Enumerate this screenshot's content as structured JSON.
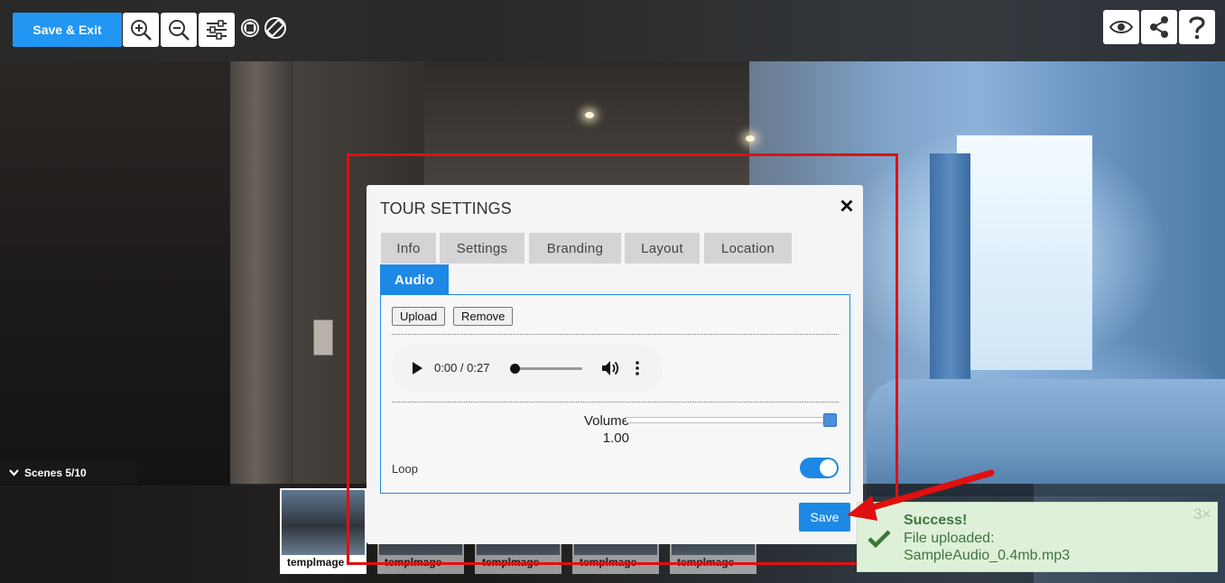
{
  "toolbar": {
    "save_exit_label": "Save & Exit",
    "tools": [
      {
        "icon": "zoom-in-icon"
      },
      {
        "icon": "zoom-out-icon"
      },
      {
        "icon": "sliders-icon"
      },
      {
        "icon": "stop-icon"
      },
      {
        "icon": "rotate-screen-icon"
      }
    ],
    "right_buttons": [
      {
        "icon": "eye-icon"
      },
      {
        "icon": "share-icon"
      },
      {
        "icon": "help-icon"
      }
    ]
  },
  "scenes": {
    "label": "Scenes 5/10",
    "thumbnails": [
      {
        "caption": "templmage"
      },
      {
        "caption": "templmage"
      },
      {
        "caption": "templmage"
      },
      {
        "caption": "templmage"
      },
      {
        "caption": "templmage"
      }
    ]
  },
  "modal": {
    "title": "TOUR SETTINGS",
    "tabs": [
      {
        "label": "Info"
      },
      {
        "label": "Settings"
      },
      {
        "label": "Branding"
      },
      {
        "label": "Layout"
      },
      {
        "label": "Location"
      },
      {
        "label": "Audio"
      }
    ],
    "active_tab": "Audio",
    "audio": {
      "upload_label": "Upload",
      "remove_label": "Remove",
      "player_time": "0:00 / 0:27",
      "volume_label": "Volume",
      "volume_value": "1.00",
      "loop_label": "Loop",
      "loop_on": true
    },
    "save_label": "Save"
  },
  "toast": {
    "title": "Success!",
    "line1": "File uploaded:",
    "line2": "SampleAudio_0.4mb.mp3",
    "count": "3×"
  },
  "colors": {
    "primary": "#1e88e5",
    "highlight": "#e01010",
    "success_bg": "#dff0d8",
    "success_text": "#3c763d"
  }
}
